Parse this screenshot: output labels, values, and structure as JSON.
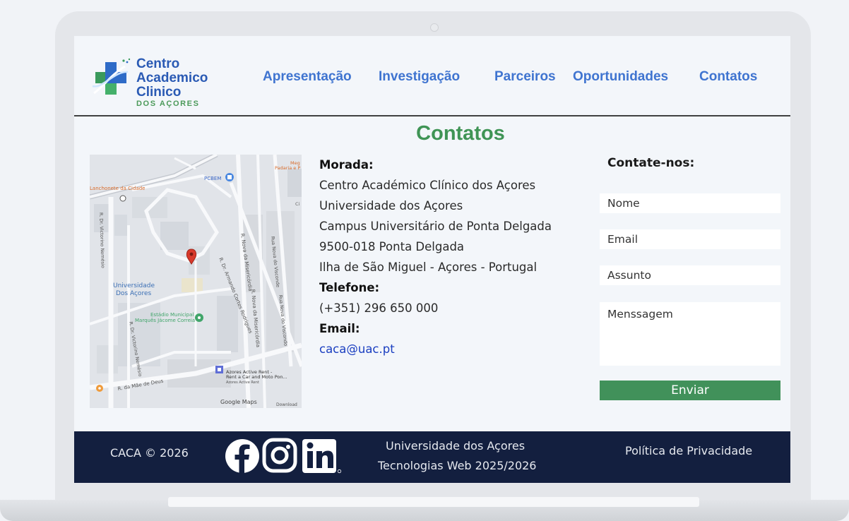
{
  "brand": {
    "line1": "Centro",
    "line2": "Academico",
    "line3": "Clinico",
    "sub": "DOS AÇORES",
    "colors": {
      "primary": "#2a5ab4",
      "green": "#4c9a5a"
    }
  },
  "nav": {
    "items": [
      {
        "label": "Apresentação"
      },
      {
        "label": "Investigação"
      },
      {
        "label": "Parceiros"
      },
      {
        "label": "Oportunidades"
      },
      {
        "label": "Contatos"
      }
    ],
    "color": "#3f74d0"
  },
  "page": {
    "title": "Contatos"
  },
  "map": {
    "labels": {
      "lanchonete": "Lanchonete da Cidade",
      "pcbem": "PCBEM",
      "universidade_1": "Universidade",
      "universidade_2": "Dos Açores",
      "estadio_1": "Estádio Municipal",
      "estadio_2": "Marquês Jácome Correia",
      "rua_nova_misericordia": "R. Nova da Misericórdia",
      "rua_nova_misericordia_2": "R. Nova da Misericórdia",
      "rua_armando": "R. Dr. Armando Cortes Rodrigues",
      "rua_viscondo": "Rua Nova do Visconde",
      "rua_viscondo_2": "Rua Nova do Viscondo",
      "rua_victorino": "R. Dr. Victorino Nemésio",
      "rua_victorino_2": "R. Dr. Victorino Nemésio",
      "rua_mae_deus": "R. da Mãe de Deus",
      "azores_rent_1": "Azores Active Rent -",
      "azores_rent_2": "Rent a Car and Moto Pon...",
      "azores_rent_3": "Azores Active Rent",
      "google_maps": "Google Maps",
      "downloads": "Download",
      "meg": "Meg",
      "padaria": "Padaria e P",
      "ci": "Ci"
    }
  },
  "contact_info": {
    "morada_label": "Morada:",
    "address": [
      "Centro Académico Clínico dos Açores",
      "Universidade dos Açores",
      "Campus Universitário de Ponta Delgada",
      "9500-018 Ponta Delgada",
      "Ilha de São Miguel - Açores - Portugal"
    ],
    "telefone_label": "Telefone:",
    "telefone": "(+351) 296 650 000",
    "email_label": "Email:",
    "email": "caca@uac.pt"
  },
  "form": {
    "title": "Contate-nos:",
    "name_placeholder": "Nome",
    "email_placeholder": "Email",
    "subject_placeholder": "Assunto",
    "message_placeholder": "Menssagem",
    "submit_label": "Enviar",
    "button_color": "#41915a"
  },
  "footer": {
    "copyright": "CACA © 2026",
    "uni_line1": "Universidade dos Açores",
    "uni_line2": "Tecnologias Web 2025/2026",
    "privacy": "Política de Privacidade",
    "social_icons": [
      "facebook-icon",
      "instagram-icon",
      "linkedin-icon"
    ],
    "background": "#131f3f"
  }
}
